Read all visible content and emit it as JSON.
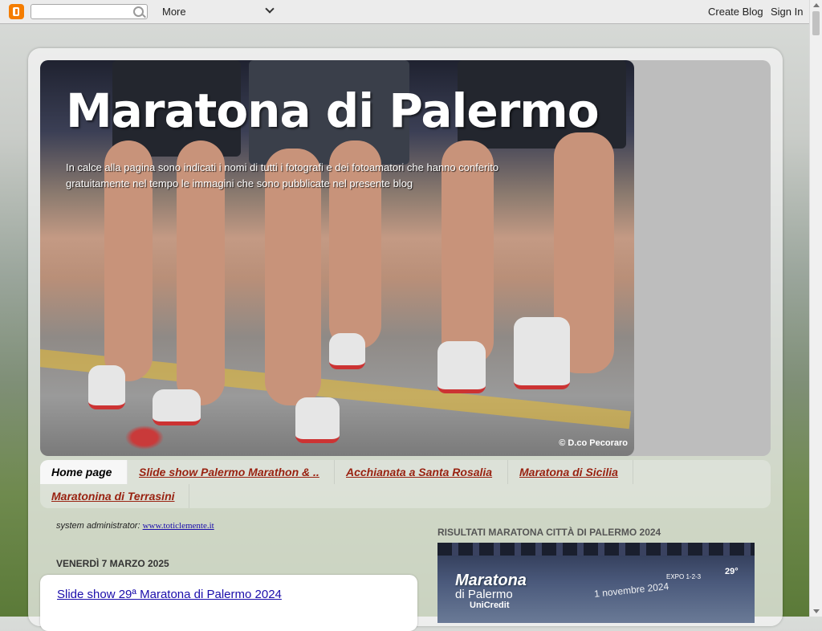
{
  "navbar": {
    "search_placeholder": "",
    "more_label": "More",
    "create_blog_label": "Create Blog",
    "sign_in_label": "Sign In"
  },
  "header": {
    "title": "Maratona di Palermo",
    "description": "In calce alla pagina sono indicati i nomi di tutti i fotografi e dei fotoamatori che hanno conferito gratuitamente nel tempo le immagini che sono pubblicate nel presente blog",
    "photo_credit": "© D.co Pecoraro"
  },
  "tabs": [
    {
      "label": "Home page",
      "active": true
    },
    {
      "label": "Slide show Palermo Marathon & ..",
      "active": false
    },
    {
      "label": "Acchianata a Santa Rosalia",
      "active": false
    },
    {
      "label": "Maratona di Sicilia",
      "active": false
    },
    {
      "label": "Maratonina di Terrasini",
      "active": false
    }
  ],
  "main": {
    "sysadmin_label": "system administrator:",
    "sysadmin_link": "www.toticlemente.it",
    "date_header": "VENERDÌ 7 MARZO 2025",
    "post_title": "Slide show 29ª Maratona di Palermo 2024"
  },
  "sidebar": {
    "widget_title": "RISULTATI MARATONA CITTÀ DI PALERMO 2024",
    "image_title": "Maratona",
    "image_subtitle": "di Palermo",
    "image_sponsor": "UniCredit",
    "image_date": "1 novembre 2024",
    "image_expo": "EXPO 1-2-3",
    "image_edition": "29°"
  },
  "colors": {
    "accent_link": "#992211",
    "post_link": "#1a0dab",
    "blogger_orange": "#f57d00"
  }
}
